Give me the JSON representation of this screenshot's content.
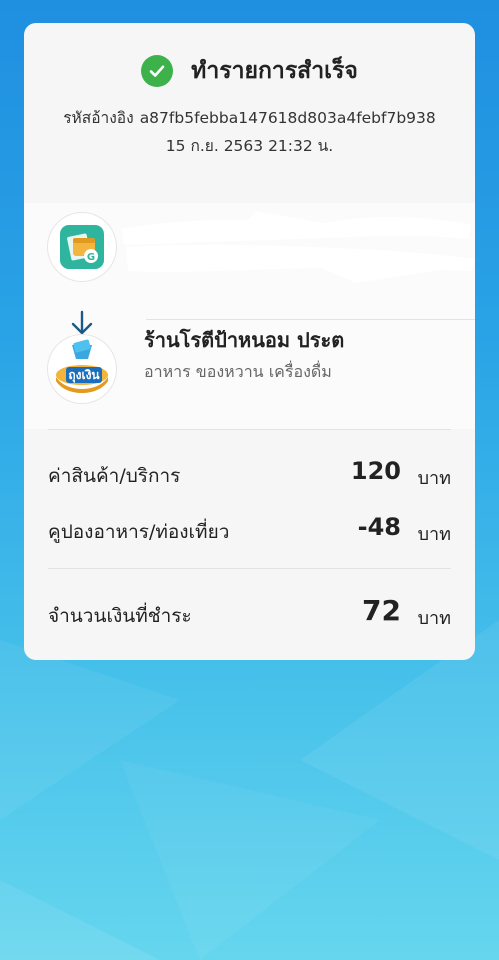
{
  "status": {
    "title": "ทำรายการสำเร็จ"
  },
  "reference": {
    "label": "รหัสอ้างอิง",
    "code": "a87fb5febba147618d803a4febf7b938"
  },
  "datetime": "15 ก.ย. 2563 21:32 น.",
  "sender": {
    "avatar_icon": "wallet-app-icon"
  },
  "receiver": {
    "name": "ร้านโรตีป้าหนอม ประต",
    "category": "อาหาร ของหวาน เครื่องดื่ม",
    "avatar_icon": "tung-ngern-logo",
    "logo_text": "ถุงเงิน"
  },
  "breakdown": [
    {
      "label": "ค่าสินค้า/บริการ",
      "amount": "120",
      "unit": "บาท"
    },
    {
      "label": "คูปองอาหาร/ท่องเที่ยว",
      "amount": "-48",
      "unit": "บาท"
    }
  ],
  "total": {
    "label": "จำนวนเงินที่ชำระ",
    "amount": "72",
    "unit": "บาท"
  },
  "colors": {
    "success": "#3db14a",
    "card": "#f6f6f7",
    "background_top": "#1f8fe0",
    "background_bottom": "#66d6ee",
    "arrow": "#1b5a86"
  }
}
